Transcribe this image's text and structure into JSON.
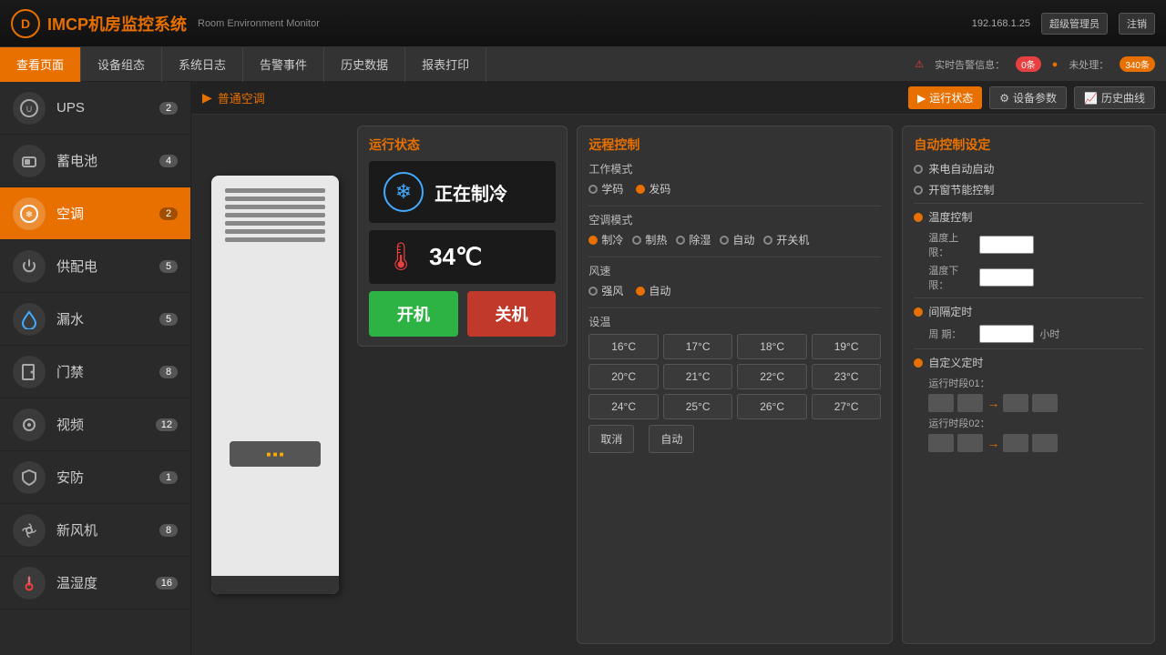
{
  "app": {
    "logo": "D",
    "title": "IMCP机房监控系统",
    "subtitle": "Room Environment Monitor",
    "ip": "192.168.1.25",
    "user": "超级管理员",
    "logout": "注销"
  },
  "navbar": {
    "items": [
      {
        "label": "查看页面",
        "active": true
      },
      {
        "label": "设备组态",
        "active": false
      },
      {
        "label": "系统日志",
        "active": false
      },
      {
        "label": "告警事件",
        "active": false
      },
      {
        "label": "历史数据",
        "active": false
      },
      {
        "label": "报表打印",
        "active": false
      }
    ],
    "alert_label": "实时告警信息：",
    "alert_count": "0条",
    "unprocessed_label": "未处理：",
    "unprocessed_count": "340条"
  },
  "sidebar": {
    "items": [
      {
        "label": "UPS",
        "count": "2",
        "icon": "⬤"
      },
      {
        "label": "蓄电池",
        "count": "4",
        "icon": "⬤"
      },
      {
        "label": "空调",
        "count": "2",
        "icon": "⬤",
        "active": true
      },
      {
        "label": "供配电",
        "count": "5",
        "icon": "⬤"
      },
      {
        "label": "漏水",
        "count": "5",
        "icon": "⬤"
      },
      {
        "label": "门禁",
        "count": "8",
        "icon": "⬤"
      },
      {
        "label": "视频",
        "count": "12",
        "icon": "⬤"
      },
      {
        "label": "安防",
        "count": "1",
        "icon": "⬤"
      },
      {
        "label": "新风机",
        "count": "8",
        "icon": "⬤"
      },
      {
        "label": "温湿度",
        "count": "16",
        "icon": "⬤"
      }
    ]
  },
  "breadcrumb": "普通空调",
  "header_buttons": {
    "running": "运行状态",
    "settings": "设备参数",
    "history": "历史曲线"
  },
  "op_status": {
    "title": "运行状态",
    "mode": "正在制冷",
    "temperature": "34℃",
    "btn_on": "开机",
    "btn_off": "关机"
  },
  "remote_control": {
    "title": "远程控制",
    "work_mode_label": "工作模式",
    "work_modes": [
      {
        "label": "学码",
        "selected": false
      },
      {
        "label": "发码",
        "selected": true
      }
    ],
    "ac_mode_label": "空调模式",
    "ac_modes": [
      {
        "label": "制冷",
        "selected": true
      },
      {
        "label": "制热",
        "selected": false
      },
      {
        "label": "除湿",
        "selected": false
      },
      {
        "label": "自动",
        "selected": false
      },
      {
        "label": "开关机",
        "selected": false
      }
    ],
    "fan_label": "风速",
    "fan_modes": [
      {
        "label": "强风",
        "selected": false
      },
      {
        "label": "自动",
        "selected": true
      }
    ],
    "settemp_label": "设温",
    "temp_buttons": [
      "16°C",
      "17°C",
      "18°C",
      "19°C",
      "20°C",
      "21°C",
      "22°C",
      "23°C",
      "24°C",
      "25°C",
      "26°C",
      "27°C"
    ],
    "special_buttons": [
      "取消",
      "自动"
    ]
  },
  "auto_control": {
    "title": "自动控制设定",
    "options": [
      {
        "label": "来电自动启动",
        "on": false
      },
      {
        "label": "开窗节能控制",
        "on": false
      },
      {
        "label": "温度控制",
        "on": true
      },
      {
        "label": "间隔定时",
        "on": true
      },
      {
        "label": "自定义定时",
        "on": true
      }
    ],
    "temp_upper_label": "温度上限：",
    "temp_lower_label": "温度下限：",
    "period_label": "周  期：",
    "period_unit": "小时",
    "time_range1_label": "运行时段01：",
    "time_range2_label": "运行时段02：",
    "arrow": "→"
  }
}
